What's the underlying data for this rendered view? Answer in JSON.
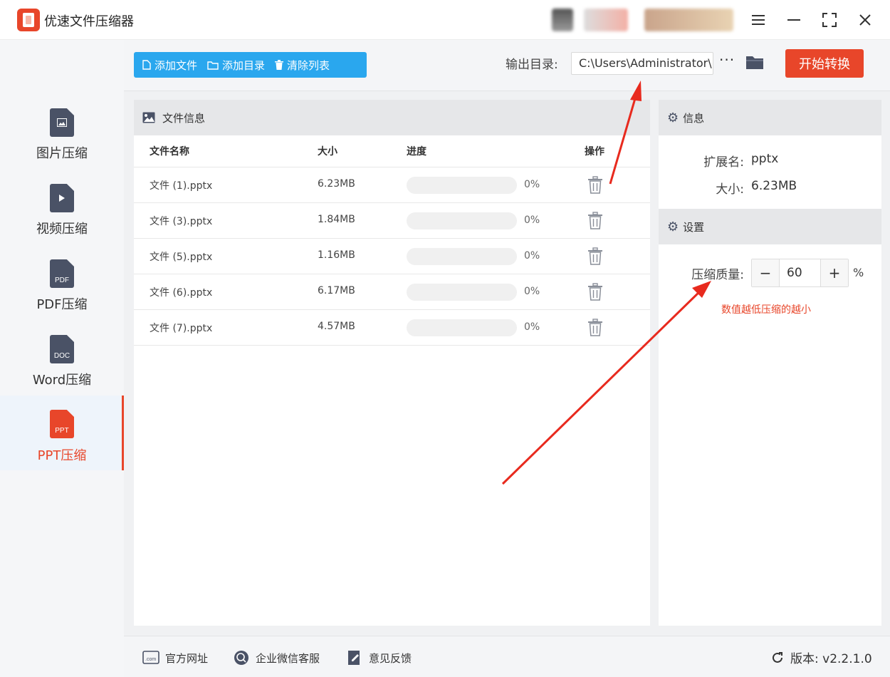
{
  "app": {
    "title": "优速文件压缩器"
  },
  "window": {
    "menu_icon": "menu-icon",
    "min_icon": "minimize-icon",
    "max_icon": "maximize-icon",
    "close_icon": "close-icon"
  },
  "sidebar": {
    "items": [
      {
        "label": "图片压缩",
        "icon": "image-file-icon",
        "badge": ""
      },
      {
        "label": "视频压缩",
        "icon": "video-file-icon",
        "badge": ""
      },
      {
        "label": "PDF压缩",
        "icon": "pdf-file-icon",
        "badge": "PDF"
      },
      {
        "label": "Word压缩",
        "icon": "doc-file-icon",
        "badge": "DOC"
      },
      {
        "label": "PPT压缩",
        "icon": "ppt-file-icon",
        "badge": "PPT",
        "active": true
      }
    ]
  },
  "toolbar": {
    "add_file": "添加文件",
    "add_dir": "添加目录",
    "clear_list": "清除列表",
    "output_label": "输出目录:",
    "output_path": "C:\\Users\\Administrator\\",
    "more": "···",
    "start": "开始转换"
  },
  "file_panel": {
    "title": "文件信息",
    "columns": {
      "name": "文件名称",
      "size": "大小",
      "progress": "进度",
      "action": "操作"
    },
    "rows": [
      {
        "name": "文件 (1).pptx",
        "size": "6.23MB",
        "progress": 0,
        "progress_text": "0%"
      },
      {
        "name": "文件 (3).pptx",
        "size": "1.84MB",
        "progress": 0,
        "progress_text": "0%"
      },
      {
        "name": "文件 (5).pptx",
        "size": "1.16MB",
        "progress": 0,
        "progress_text": "0%"
      },
      {
        "name": "文件 (6).pptx",
        "size": "6.17MB",
        "progress": 0,
        "progress_text": "0%"
      },
      {
        "name": "文件 (7).pptx",
        "size": "4.57MB",
        "progress": 0,
        "progress_text": "0%"
      }
    ]
  },
  "info_panel": {
    "title": "信息",
    "ext_label": "扩展名:",
    "ext_value": "pptx",
    "size_label": "大小:",
    "size_value": "6.23MB"
  },
  "settings": {
    "title": "设置",
    "quality_label": "压缩质量:",
    "quality_value": "60",
    "minus": "−",
    "plus": "+",
    "unit": "%",
    "hint": "数值越低压缩的越小"
  },
  "footer": {
    "website": "官方网址",
    "wechat": "企业微信客服",
    "feedback": "意见反馈",
    "version": "版本: v2.2.1.0"
  },
  "colors": {
    "accent": "#e8462a",
    "primary": "#2aa7ee"
  }
}
